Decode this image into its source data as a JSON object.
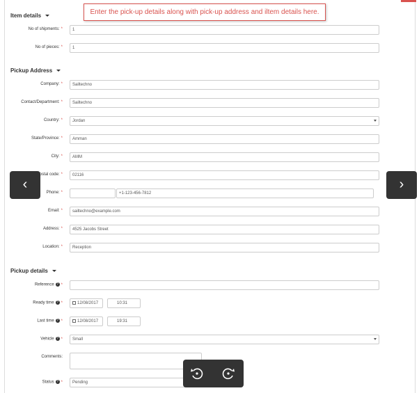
{
  "tip_text": "Enter the pick-up details along with pick-up address and iltem details here.",
  "item_details": {
    "title": "Item details",
    "no_of_shipments_label": "No of shipments:",
    "no_of_shipments_value": "1",
    "no_of_pieces_label": "No of pieces:",
    "no_of_pieces_value": "1"
  },
  "pickup_address": {
    "title": "Pickup Address",
    "company_label": "Company:",
    "company_value": "Sailtechno",
    "contact_label": "Contact/Department:",
    "contact_value": "Sailtechno",
    "country_label": "Country:",
    "country_value": "Jordan",
    "state_label": "State/Province:",
    "state_value": "Amman",
    "city_label": "City:",
    "city_value": "AMM",
    "postal_label": "Postal code:",
    "postal_value": "02116",
    "phone_label": "Phone:",
    "phone_value": "+1-123-456-7812",
    "email_label": "Email:",
    "email_value": "sailtechno@example.com",
    "address_label": "Address:",
    "address_value": "4525 Jacobs Street",
    "location_label": "Location:",
    "location_value": "Reception"
  },
  "pickup_details": {
    "title": "Pickup details",
    "reference_label": "Reference",
    "ready_time_label": "Ready time",
    "ready_date": "12/08/2017",
    "ready_time": "10:31",
    "last_time_label": "Last time",
    "last_date": "12/08/2017",
    "last_time": "19:31",
    "vehicle_label": "Vehicle",
    "vehicle_value": "Small",
    "comments_label": "Comments:",
    "status_label": "Status",
    "status_value": "Pending"
  },
  "nav": {
    "prev": "‹",
    "next": "›"
  },
  "colors": {
    "required": "#d9534f",
    "tip_border": "#d9534f",
    "nav_bg": "#333333"
  }
}
